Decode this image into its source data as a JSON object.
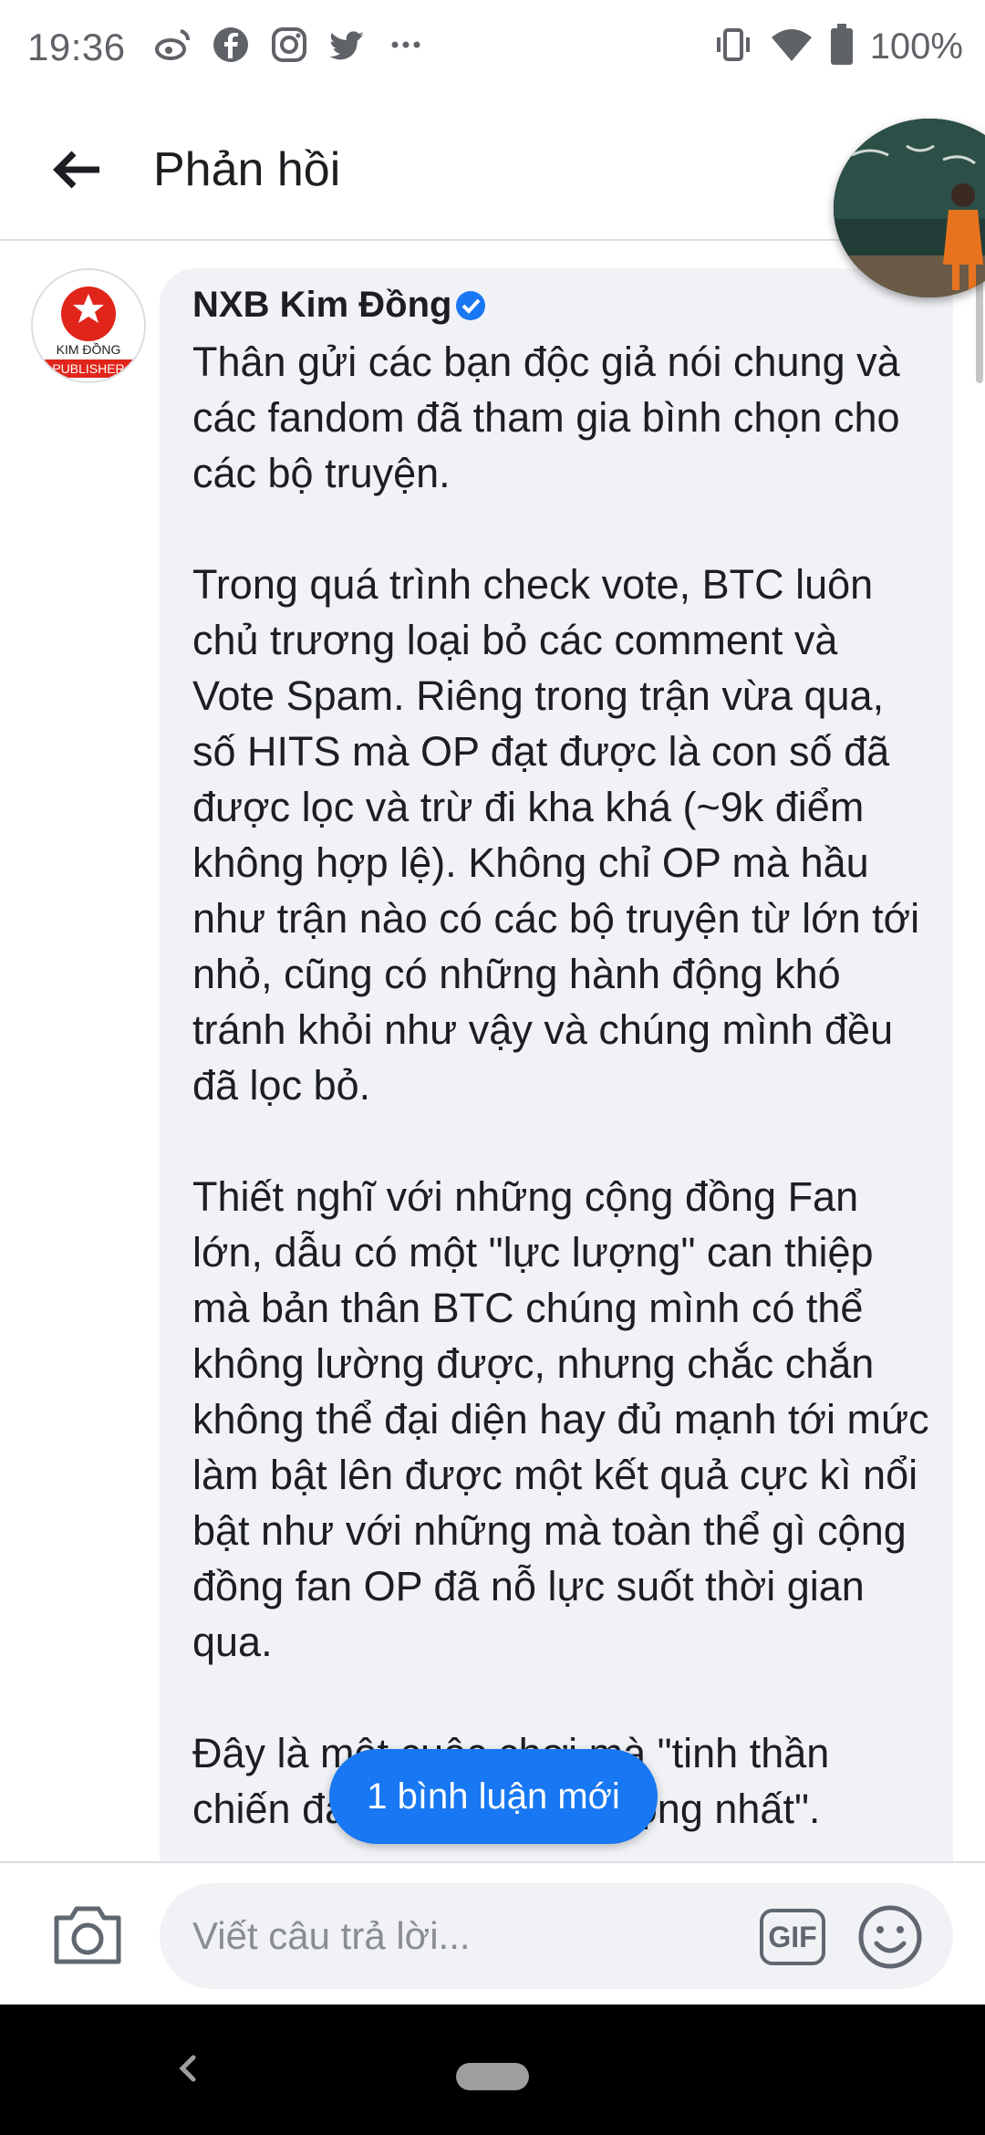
{
  "status_bar": {
    "time": "19:36",
    "left_icons": [
      "weibo-icon",
      "facebook-icon",
      "instagram-icon",
      "twitter-icon",
      "more-dots-icon"
    ],
    "right_icons": [
      "vibrate-icon",
      "wifi-icon",
      "battery-icon"
    ],
    "battery": "100%"
  },
  "header": {
    "title": "Phản hồi",
    "back_icon": "arrow-left-icon"
  },
  "comment": {
    "author": "NXB Kim Đồng",
    "verified": true,
    "avatar_logo": {
      "text_top": "KIM ĐỒNG",
      "text_bottom": "PUBLISHER",
      "brand_color": "#e1251b"
    },
    "text": "Thân gửi các bạn độc giả nói chung và các fandom đã tham gia bình chọn cho các bộ truyện.\n\nTrong quá trình check vote, BTC luôn chủ trương loại bỏ các comment và Vote Spam. Riêng trong trận vừa qua, số HITS mà OP đạt được là con số đã được lọc và trừ đi kha khá (~9k điểm không hợp lệ). Không chỉ OP mà hầu như trận nào có các bộ truyện từ lớn tới nhỏ, cũng có những hành động khó tránh khỏi như vậy và chúng mình đều đã lọc bỏ.\n\nThiết nghĩ với những cộng đồng Fan lớn, dẫu có một \"lực lượng\" can thiệp mà bản thân BTC chúng mình có thể không lường được, nhưng chắc chắn không thể đại diện hay đủ mạnh tới mức làm bật lên được một kết quả cực kì nổi bật như với những mà toàn thể gì cộng đồng fan OP đã nỗ lực suốt thời gian qua.\n\nĐây là một cuộc chơi mà \"tinh thần chiến đấu mới là quan trọng nhất\"."
  },
  "new_comments_pill": "1 bình luận mới",
  "reply_bar": {
    "placeholder": "Viết câu trả lời...",
    "gif_label": "GIF",
    "camera_icon": "camera-icon",
    "emoji_icon": "emoji-icon"
  },
  "colors": {
    "accent": "#1877f2",
    "bubble": "#f0f2f5",
    "text": "#1c1e21"
  }
}
